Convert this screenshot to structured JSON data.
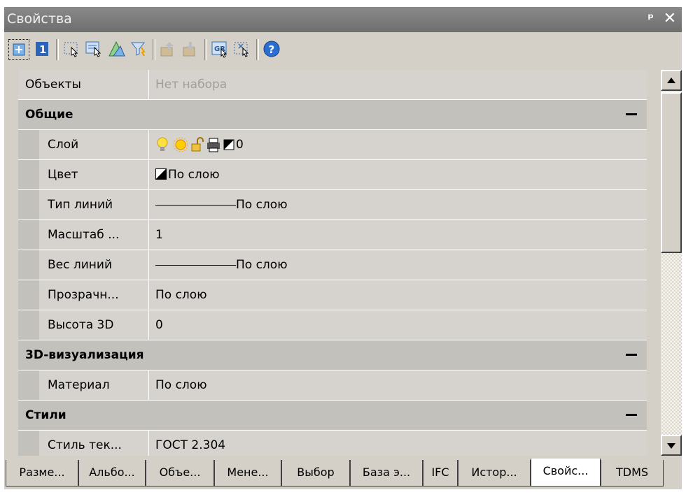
{
  "window": {
    "title": "Свойства",
    "pin_glyph": "ᵖ",
    "close_glyph": "✕"
  },
  "toolbar": {
    "icons": [
      "add-to-selection-icon",
      "single-object-icon",
      "select-objects-icon",
      "quick-select-icon",
      "select-similar-icon",
      "filter-icon",
      "move-up-icon",
      "move-down-icon",
      "select-group-icon",
      "deselect-icon",
      "help-icon"
    ]
  },
  "grid": {
    "objects_label": "Объекты",
    "objects_value": "Нет набора",
    "general": "Общие",
    "layer_label": "Слой",
    "layer_value": "0",
    "color_label": "Цвет",
    "color_value": "По слою",
    "linetype_label": "Тип линий",
    "linetype_value": "По слою",
    "scale_label": "Масштаб ...",
    "scale_value": "1",
    "lineweight_label": "Вес линий",
    "lineweight_value": "По слою",
    "transparency_label": "Прозрачн...",
    "transparency_value": "По слою",
    "height3d_label": "Высота 3D",
    "height3d_value": "0",
    "viz3d": "3D-визуализация",
    "material_label": "Материал",
    "material_value": "По слою",
    "styles": "Стили",
    "textstyle_label": "Стиль тек...",
    "textstyle_value": "ГОСТ 2.304"
  },
  "tabs": [
    "Разме...",
    "Альбо...",
    "Объе...",
    "Мене...",
    "Выбор",
    "База э...",
    "IFC",
    "Истор...",
    "Свойс...",
    "TDMS"
  ],
  "active_tab": "Свойс..."
}
